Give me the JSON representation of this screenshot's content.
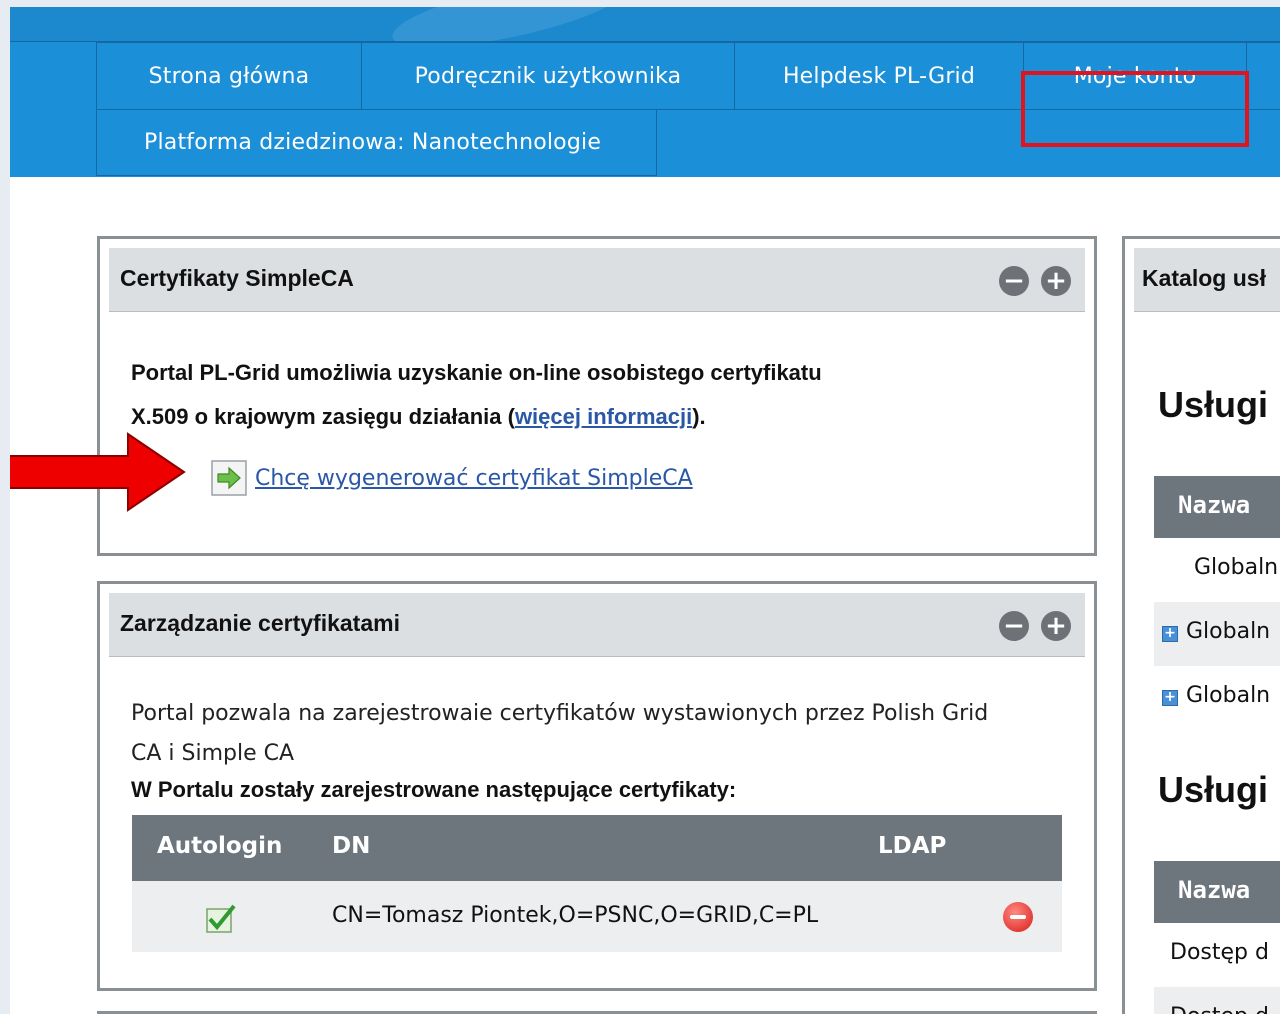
{
  "nav": {
    "tabs": [
      {
        "label": "Strona główna"
      },
      {
        "label": "Podręcznik użytkownika"
      },
      {
        "label": "Helpdesk PL-Grid"
      },
      {
        "label": "Moje konto"
      },
      {
        "label": "Platforma dziedzinowa: Nanotechnologie"
      }
    ]
  },
  "simpleca": {
    "title": "Certyfikaty SimpleCA",
    "intro_line1": "Portal PL-Grid umożliwia uzyskanie on-line osobistego certyfikatu",
    "intro_line2_pre": "X.509 o krajowym zasięgu działania (",
    "intro_link": "więcej informacji",
    "intro_line2_post": ").",
    "action_link": "Chcę wygenerować certyfikat SimpleCA"
  },
  "certmgmt": {
    "title": "Zarządzanie certyfikatami",
    "desc_line1": "Portal pozwala na zarejestrowaie certyfikatów wystawionych przez Polish Grid",
    "desc_line2": "CA i Simple CA",
    "registered_heading": "W Portalu zostały zarejestrowane następujące certyfikaty:",
    "table": {
      "headers": [
        "Autologin",
        "DN",
        "LDAP"
      ],
      "rows": [
        {
          "dn": "CN=Tomasz Piontek,O=PSNC,O=GRID,C=PL"
        }
      ]
    }
  },
  "catalog": {
    "title": "Katalog usł",
    "section1_heading": "Usługi",
    "section1_col": "Nazwa",
    "section1_rows": [
      "Globaln",
      "Globaln",
      "Globaln"
    ],
    "section2_heading": "Usługi",
    "section2_col": "Nazwa",
    "section2_rows": [
      "Dostęp d",
      "Dostęp d"
    ]
  },
  "colors": {
    "nav_blue": "#1b8fd7",
    "highlight_red": "#e0141e",
    "arrow_red": "#ee0000",
    "table_header": "#6e767d",
    "link_blue": "#2a57a6"
  },
  "icons": [
    "minimize-icon",
    "maximize-icon",
    "green-arrow-icon",
    "checkmark-icon",
    "remove-icon",
    "expand-icon",
    "pointer-arrow"
  ]
}
